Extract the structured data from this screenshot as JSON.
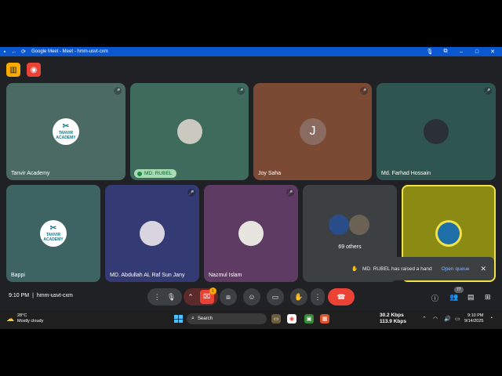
{
  "window": {
    "title": "Google Meet - Meet - hmm-usvt-cxm",
    "controls": [
      "mic-icon",
      "extension-icon",
      "minimize",
      "maximize",
      "close"
    ]
  },
  "top_icons": [
    "info-icon",
    "record-icon"
  ],
  "tiles": [
    {
      "name": "Tanvir Academy",
      "logo_text": "TANVIR ACADEMY",
      "bg": "#4a6a63",
      "muted": true
    },
    {
      "name": "MD. RUBEL",
      "bg": "#3f6b5c",
      "speaking": true,
      "muted": true
    },
    {
      "name": "Joy Saha",
      "initial": "J",
      "bg": "#7a4a35",
      "muted": true
    },
    {
      "name": "Md. Farhad Hossain",
      "bg": "#2f5550",
      "muted": true
    },
    {
      "name": "Bappi",
      "logo_text": "TANVIR ACADEMY",
      "bg": "#3e6363",
      "muted": false
    },
    {
      "name": "MD. Abdullah AL Raf Sun Jany",
      "bg": "#343a73",
      "muted": true
    },
    {
      "name": "Nazmul Islam",
      "bg": "#5e3b62",
      "muted": true
    },
    {
      "name": "69 others",
      "bg": "#3c4043"
    },
    {
      "name": "",
      "bg": "#8b8a13",
      "highlight": "#f1e24a"
    }
  ],
  "toast": {
    "message": "MD. RUBEL has raised a hand",
    "action": "Open queue"
  },
  "meeting": {
    "time": "9:10 PM",
    "separator": "|",
    "code": "hmm-usvt-cxm"
  },
  "controls": {
    "camera_badge": "1",
    "people_count": "77"
  },
  "taskbar": {
    "temperature": "28°C",
    "weather": "Mostly cloudy",
    "search_placeholder": "Search",
    "upload_speed": "30.2 Kbps",
    "download_speed": "113.9 Kbps",
    "time": "9:10 PM",
    "date": "9/14/2025"
  },
  "colors": {
    "accent": "#0b57d0",
    "end_call": "#ea4335",
    "raise_hand_queue_link": "#8ab4f8"
  }
}
